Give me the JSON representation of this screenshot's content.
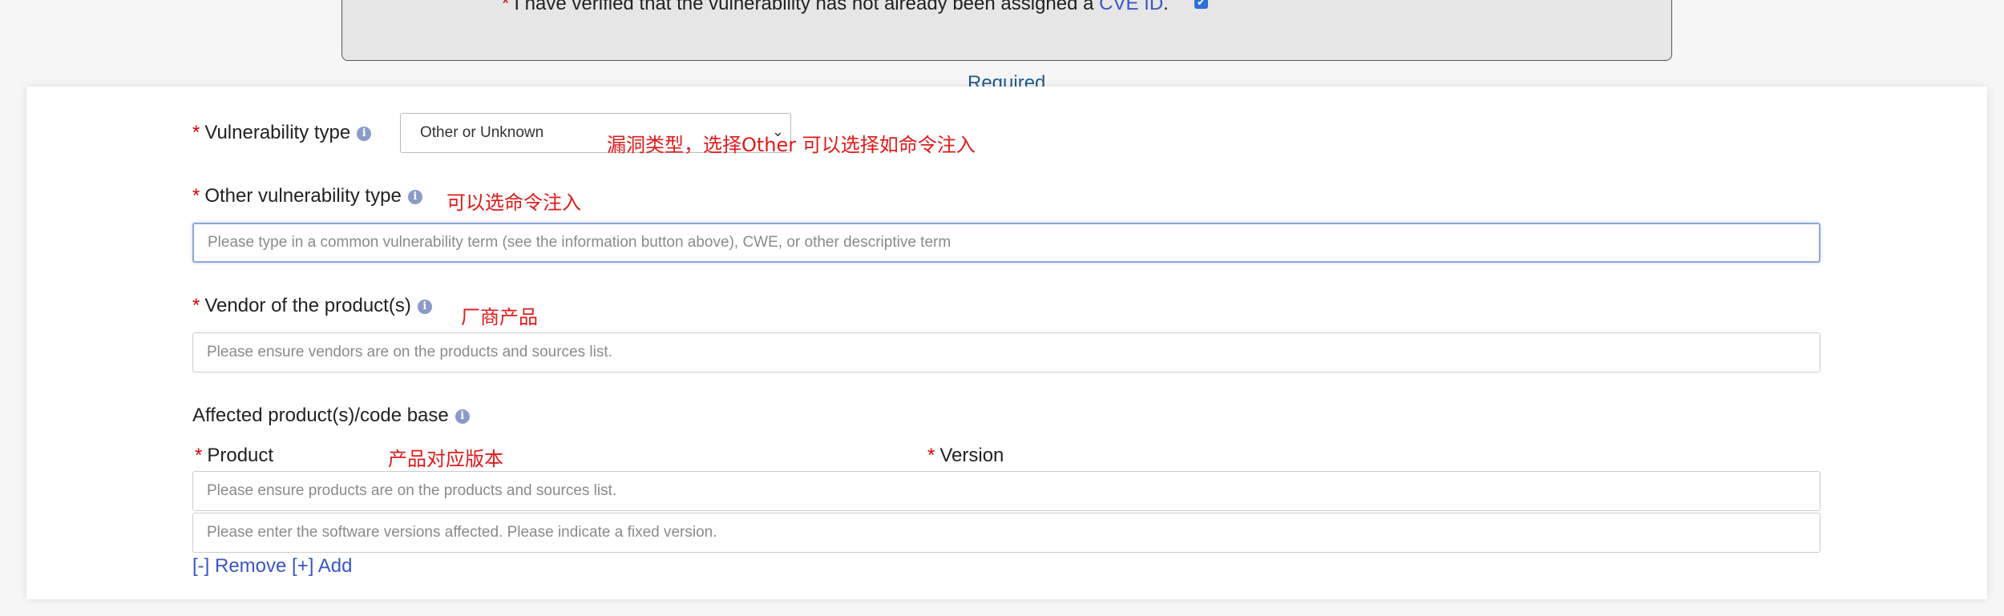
{
  "verification": {
    "prefix": "I have verified that the vulnerability has not already been assigned a ",
    "link": "CVE ID",
    "suffix": ".",
    "checked": true
  },
  "required_text": "Required",
  "vulnerability_type": {
    "label": "Vulnerability type",
    "selected": "Other or Unknown",
    "annotation": "漏洞类型，选择Other 可以选择如命令注入"
  },
  "other_vulnerability_type": {
    "label": "Other vulnerability type",
    "annotation": "可以选命令注入",
    "placeholder": "Please type in a common vulnerability term (see the information button above), CWE, or other descriptive term"
  },
  "vendor": {
    "label": "Vendor of the product(s)",
    "annotation": "厂商产品",
    "placeholder": "Please ensure vendors are on the products and sources list."
  },
  "affected": {
    "label": "Affected product(s)/code base",
    "product_label": "Product",
    "version_label": "Version",
    "annotation": "产品对应版本",
    "product_placeholder": "Please ensure products are on the products and sources list.",
    "version_placeholder": "Please enter the software versions affected. Please indicate a fixed version.",
    "remove_label": "[-] Remove",
    "add_label": "[+] Add"
  },
  "required_marker": "*",
  "info_glyph": "i",
  "colors": {
    "required_star": "#dd0000",
    "link": "#3a55c8",
    "annotation": "#e01a1a",
    "focus_border": "#8fa8d8"
  }
}
